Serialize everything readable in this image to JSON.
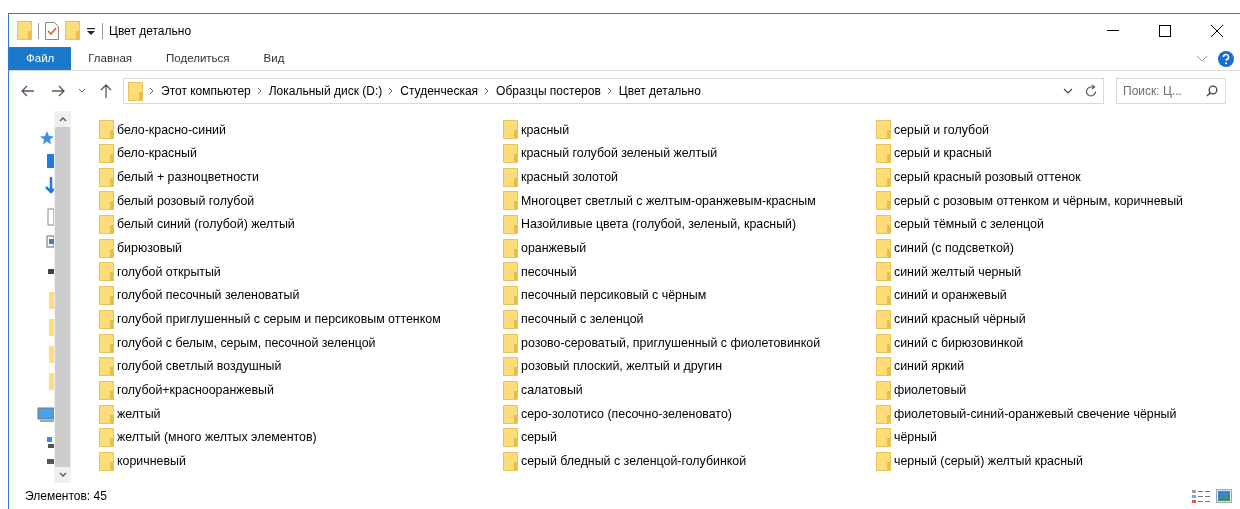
{
  "window": {
    "title": "Цвет детально"
  },
  "ribbon": {
    "tabs": [
      {
        "label": "Файл",
        "selected": true
      },
      {
        "label": "Главная",
        "selected": false
      },
      {
        "label": "Поделиться",
        "selected": false
      },
      {
        "label": "Вид",
        "selected": false
      }
    ]
  },
  "address_bar": {
    "path": [
      "Этот компьютер",
      "Локальный диск (D:)",
      "Студенческая",
      "Образцы постеров",
      "Цвет детально"
    ]
  },
  "search": {
    "placeholder": "Поиск: Ц..."
  },
  "items": [
    "бело-красно-синий",
    "бело-красный",
    "белый + разноцветности",
    "белый розовый голубой",
    "белый синий (голубой) желтый",
    "бирюзовый",
    "голубой открытый",
    "голубой песочный зеленоватый",
    "голубой приглушенный с серым и персиковым оттенком",
    "голубой с белым, серым, песочной зеленцой",
    "голубой светлый воздушный",
    "голубой+краснооранжевый",
    "желтый",
    "желтый (много желтых элементов)",
    "коричневый",
    "красный",
    "красный голубой зеленый желтый",
    "красный золотой",
    "Многоцвет светлый с желтым-оранжевым-красным",
    "Назойливые цвета (голубой, зеленый, красный)",
    "оранжевый",
    "песочный",
    "песочный персиковый с чёрным",
    "песочный с зеленцой",
    "розово-сероватый, приглушенный с фиолетовинкой",
    "розовый плоский, желтый и другин",
    "салатовый",
    "серо-золотисо (песочно-зеленовато)",
    "серый",
    "серый бледный с зеленцой-голубинкой",
    "серый и голубой",
    "серый и красный",
    "серый красный розовый оттенок",
    "серый с розовым оттенком и чёрным, коричневый",
    "серый тёмный с зеленцой",
    "синий (с подсветкой)",
    "синий желтый черный",
    "синий и оранжевый",
    "синий красный чёрный",
    "синий с бирюзовинкой",
    "синий яркий",
    "фиолетовый",
    "фиолетовый-синий-оранжевый свечение чёрный",
    "чёрный",
    "черный (серый) желтый красный"
  ],
  "status_bar": {
    "count": "Элементов: 45"
  }
}
